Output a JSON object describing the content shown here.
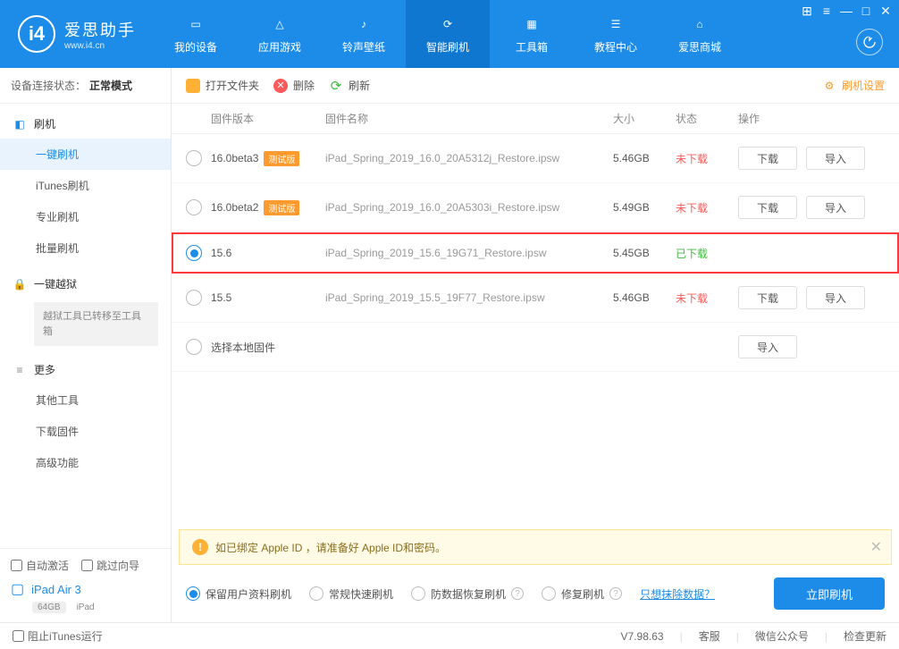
{
  "app": {
    "name_cn": "爱思助手",
    "name_en": "www.i4.cn"
  },
  "topTabs": [
    {
      "label": "我的设备"
    },
    {
      "label": "应用游戏"
    },
    {
      "label": "铃声壁纸"
    },
    {
      "label": "智能刷机"
    },
    {
      "label": "工具箱"
    },
    {
      "label": "教程中心"
    },
    {
      "label": "爱思商城"
    }
  ],
  "connStatus": {
    "label": "设备连接状态：",
    "value": "正常模式"
  },
  "nav": {
    "flash": {
      "head": "刷机",
      "items": [
        "一键刷机",
        "iTunes刷机",
        "专业刷机",
        "批量刷机"
      ]
    },
    "jailbreak": {
      "head": "一键越狱",
      "note": "越狱工具已转移至工具箱"
    },
    "more": {
      "head": "更多",
      "items": [
        "其他工具",
        "下载固件",
        "高级功能"
      ]
    }
  },
  "sidebarBottom": {
    "autoActivate": "自动激活",
    "skipGuide": "跳过向导",
    "deviceName": "iPad Air 3",
    "capacity": "64GB",
    "deviceType": "iPad"
  },
  "toolbar": {
    "openFolder": "打开文件夹",
    "delete": "删除",
    "refresh": "刷新",
    "settings": "刷机设置"
  },
  "table": {
    "headers": {
      "version": "固件版本",
      "name": "固件名称",
      "size": "大小",
      "status": "状态",
      "ops": "操作"
    },
    "btn": {
      "download": "下载",
      "import": "导入"
    },
    "statusText": {
      "no": "未下载",
      "yes": "已下载"
    },
    "betaBadge": "测试版",
    "rows": [
      {
        "version": "16.0beta3",
        "beta": true,
        "name": "iPad_Spring_2019_16.0_20A5312j_Restore.ipsw",
        "size": "5.46GB",
        "downloaded": false,
        "selected": false,
        "highlight": false
      },
      {
        "version": "16.0beta2",
        "beta": true,
        "name": "iPad_Spring_2019_16.0_20A5303i_Restore.ipsw",
        "size": "5.49GB",
        "downloaded": false,
        "selected": false,
        "highlight": false
      },
      {
        "version": "15.6",
        "beta": false,
        "name": "iPad_Spring_2019_15.6_19G71_Restore.ipsw",
        "size": "5.45GB",
        "downloaded": true,
        "selected": true,
        "highlight": true
      },
      {
        "version": "15.5",
        "beta": false,
        "name": "iPad_Spring_2019_15.5_19F77_Restore.ipsw",
        "size": "5.46GB",
        "downloaded": false,
        "selected": false,
        "highlight": false
      }
    ],
    "localRow": "选择本地固件"
  },
  "warning": "如已绑定 Apple ID ，请准备好 Apple ID和密码。",
  "options": {
    "keepData": "保留用户资料刷机",
    "normal": "常规快速刷机",
    "antiRecovery": "防数据恢复刷机",
    "repair": "修复刷机",
    "eraseLink": "只想抹除数据？",
    "flashBtn": "立即刷机"
  },
  "footer": {
    "blockItunes": "阻止iTunes运行",
    "version": "V7.98.63",
    "service": "客服",
    "wechat": "微信公众号",
    "update": "检查更新"
  }
}
